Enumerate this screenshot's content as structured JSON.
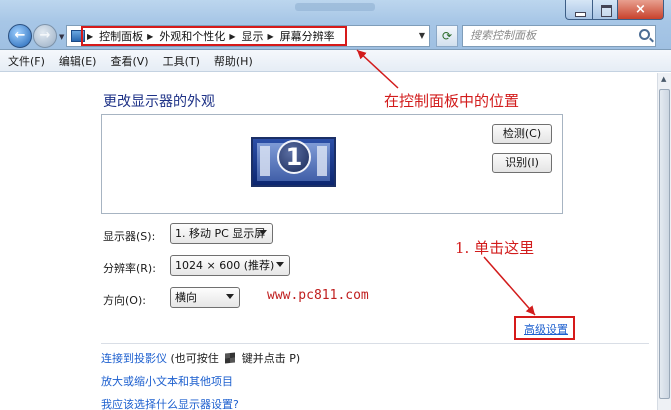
{
  "address_bar": {
    "crumbs": [
      "控制面板",
      "外观和个性化",
      "显示",
      "屏幕分辨率"
    ]
  },
  "search": {
    "placeholder": "搜索控制面板"
  },
  "menu": [
    "文件(F)",
    "编辑(E)",
    "查看(V)",
    "工具(T)",
    "帮助(H)"
  ],
  "page": {
    "title": "更改显示器的外观",
    "monitor_number": "1",
    "detect_label": "检测(C)",
    "identify_label": "识别(I)",
    "display_label": "显示器(S):",
    "display_value": "1. 移动 PC 显示屏",
    "resolution_label": "分辨率(R):",
    "resolution_value": "1024 × 600 (推荐)",
    "orientation_label": "方向(O):",
    "orientation_value": "横向",
    "advanced_link": "高级设置",
    "links": {
      "projector_text": "连接到投影仪",
      "projector_hint_a": "(也可按住",
      "projector_hint_b": "键并点击 P)",
      "text_size": "放大或缩小文本和其他项目",
      "which_settings": "我应该选择什么显示器设置?"
    }
  },
  "watermark": "www.pc811.com",
  "annotations": {
    "location": "在控制面板中的位置",
    "click_here": "1. 单击这里"
  },
  "colors": {
    "annotation": "#d21c1c",
    "link": "#1c5fcf",
    "title_blue": "#1e3287"
  },
  "icons": {
    "back": "back-arrow-icon",
    "forward": "forward-arrow-icon",
    "refresh": "refresh-icon",
    "search": "search-icon",
    "windows_key": "windows-logo-icon"
  }
}
